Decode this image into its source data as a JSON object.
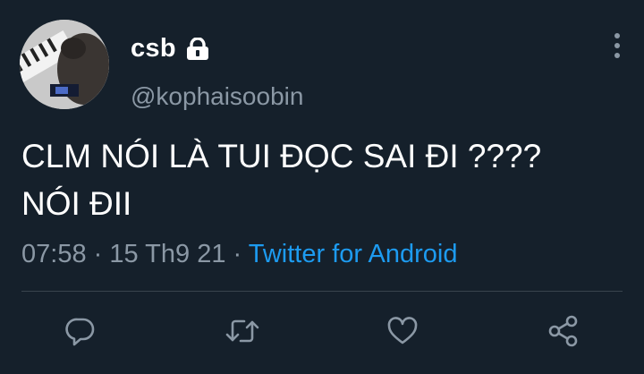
{
  "user": {
    "display_name": "csb",
    "handle": "@kophaisoobin",
    "protected": true
  },
  "tweet": {
    "text_line1": "CLM NÓI LÀ TUI ĐỌC SAI ĐI ????",
    "text_line2": "NÓI ĐII",
    "time": "07:58",
    "date": "15 Th9 21",
    "separator": "·",
    "source": "Twitter for Android"
  },
  "actions": [
    {
      "icon": "reply-icon"
    },
    {
      "icon": "retweet-icon"
    },
    {
      "icon": "like-icon"
    },
    {
      "icon": "share-icon"
    }
  ],
  "colors": {
    "background": "#15202b",
    "text": "#ffffff",
    "secondary": "#8b98a5",
    "accent": "#1d9bf0",
    "divider": "#38444d"
  }
}
